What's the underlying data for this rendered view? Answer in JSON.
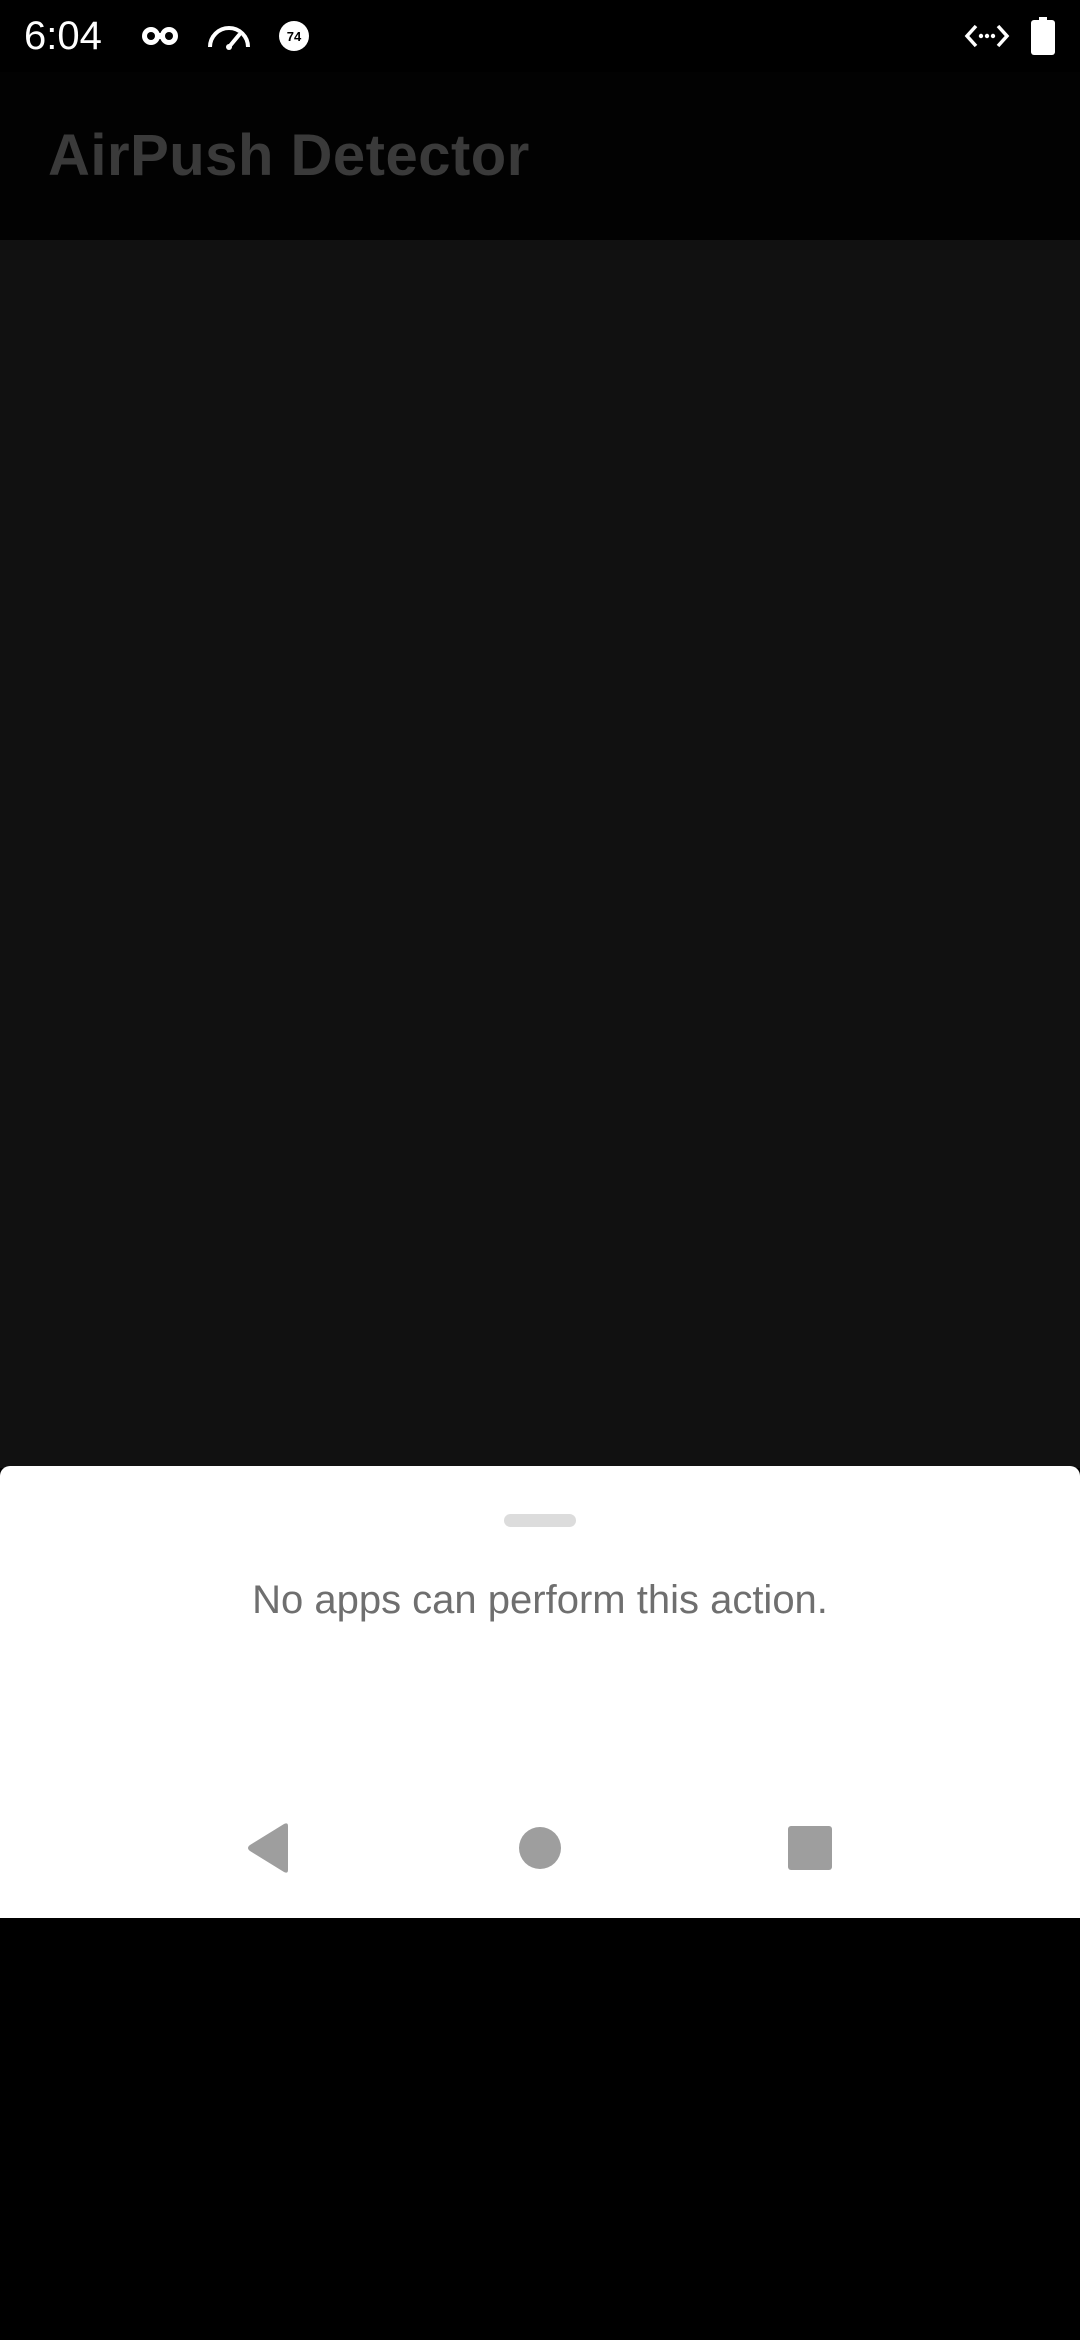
{
  "status_bar": {
    "time": "6:04",
    "icons": [
      "incognito-icon",
      "speedometer-icon",
      "data-saver-icon",
      "code-arrows-icon",
      "battery-icon"
    ],
    "data_saver_value": "74"
  },
  "app_bar": {
    "title": "AirPush Detector"
  },
  "bottom_sheet": {
    "message": "No apps can perform this action."
  },
  "nav_bar": {
    "buttons": [
      "back",
      "home",
      "recents"
    ]
  },
  "colors": {
    "background": "#000000",
    "scrim": "#111111",
    "sheet": "#ffffff",
    "title_dimmed": "#3a3a3a",
    "message_text": "#6f6f6f",
    "nav_icons": "#9e9e9e"
  }
}
